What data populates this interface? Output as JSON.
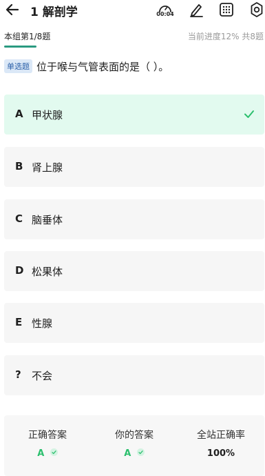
{
  "header": {
    "title": "1 解剖学",
    "timer": "00:04"
  },
  "subbar": {
    "group": "本组第1/8题",
    "progress": "当前进度12%  共8题"
  },
  "question": {
    "type_badge": "单选题",
    "text": "位于喉与气管表面的是（ ）。"
  },
  "options": [
    {
      "letter": "A",
      "text": "甲状腺"
    },
    {
      "letter": "B",
      "text": "肾上腺"
    },
    {
      "letter": "C",
      "text": "脑垂体"
    },
    {
      "letter": "D",
      "text": "松果体"
    },
    {
      "letter": "E",
      "text": "性腺"
    },
    {
      "letter": "?",
      "text": "不会"
    }
  ],
  "stats": {
    "correct_label": "正确答案",
    "correct_value": "A",
    "yours_label": "你的答案",
    "yours_value": "A",
    "rate_label": "全站正确率",
    "rate_value": "100%"
  },
  "colors": {
    "accent": "#2a9a80",
    "correct_bg": "#e2faef",
    "correct_text": "#2bbf6d"
  }
}
